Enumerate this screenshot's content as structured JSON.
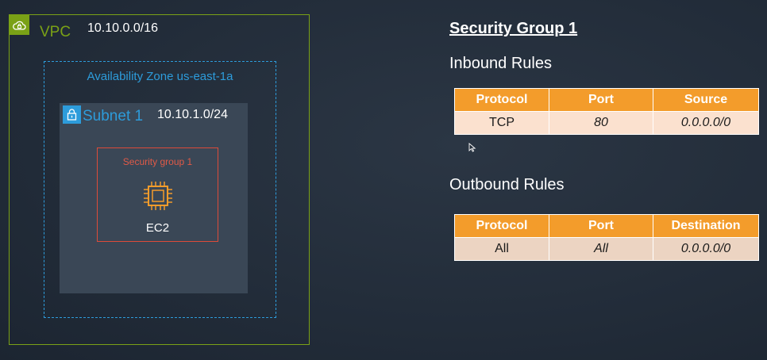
{
  "diagram": {
    "vpc": {
      "label": "VPC",
      "cidr": "10.10.0.0/16",
      "icon": "vpc-cloud-icon"
    },
    "availability_zone": {
      "label": "Availability Zone us-east-1a"
    },
    "subnet": {
      "label": "Subnet 1",
      "cidr": "10.10.1.0/24",
      "icon": "lock-icon"
    },
    "security_group": {
      "label": "Security group 1"
    },
    "instance": {
      "label": "EC2",
      "icon": "chip-icon"
    }
  },
  "panel": {
    "title": "Security Group 1",
    "inbound": {
      "title": "Inbound Rules",
      "headers": [
        "Protocol",
        "Port",
        "Source"
      ],
      "rows": [
        [
          "TCP",
          "80",
          "0.0.0.0/0"
        ]
      ]
    },
    "outbound": {
      "title": "Outbound Rules",
      "headers": [
        "Protocol",
        "Port",
        "Destination"
      ],
      "rows": [
        [
          "All",
          "All",
          "0.0.0.0/0"
        ]
      ]
    }
  },
  "colors": {
    "background": "#232f3e",
    "vpc": "#7aa116",
    "az_subnet": "#2d9cdb",
    "security_group": "#dd4b39",
    "chip": "#f39c2b",
    "table_header": "#f39c2b",
    "table_row": "#fbe1cf"
  }
}
